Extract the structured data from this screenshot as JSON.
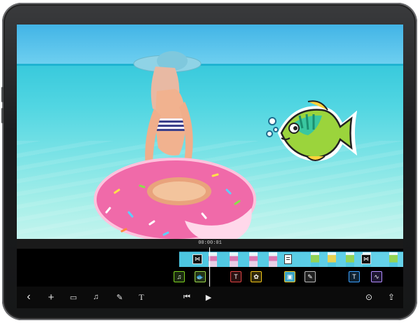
{
  "app": {
    "preview": {
      "description_icon_names": [
        "fish-sticker-icon"
      ]
    },
    "timeline": {
      "timecode": "00:00:01",
      "track_items": [
        {
          "icon": "music-note-icon",
          "glyph": "♫",
          "color": "#7ed321"
        },
        {
          "icon": "fish-sticker-icon",
          "glyph": "🐟",
          "color": "#9ad54a"
        },
        {
          "icon": "text-icon",
          "glyph": "T",
          "color": "#e04444"
        },
        {
          "icon": "sticker-icon",
          "glyph": "✿",
          "color": "#f0c419"
        },
        {
          "icon": "photo-icon",
          "glyph": "▣",
          "color": "#f0c419"
        },
        {
          "icon": "pencil-icon",
          "glyph": "✎",
          "color": "#bbbbbb"
        },
        {
          "icon": "text-icon",
          "glyph": "T",
          "color": "#3aa0ff"
        },
        {
          "icon": "audio-waveform-icon",
          "glyph": "∿",
          "color": "#b28cff"
        }
      ]
    },
    "toolbar": {
      "back": "‹",
      "add": "+",
      "media": "▭",
      "music": "♫",
      "pencil": "✎",
      "text": "T",
      "skip_back": "⏮",
      "play": "▶",
      "settings": "⊙",
      "share": "⇪"
    }
  }
}
